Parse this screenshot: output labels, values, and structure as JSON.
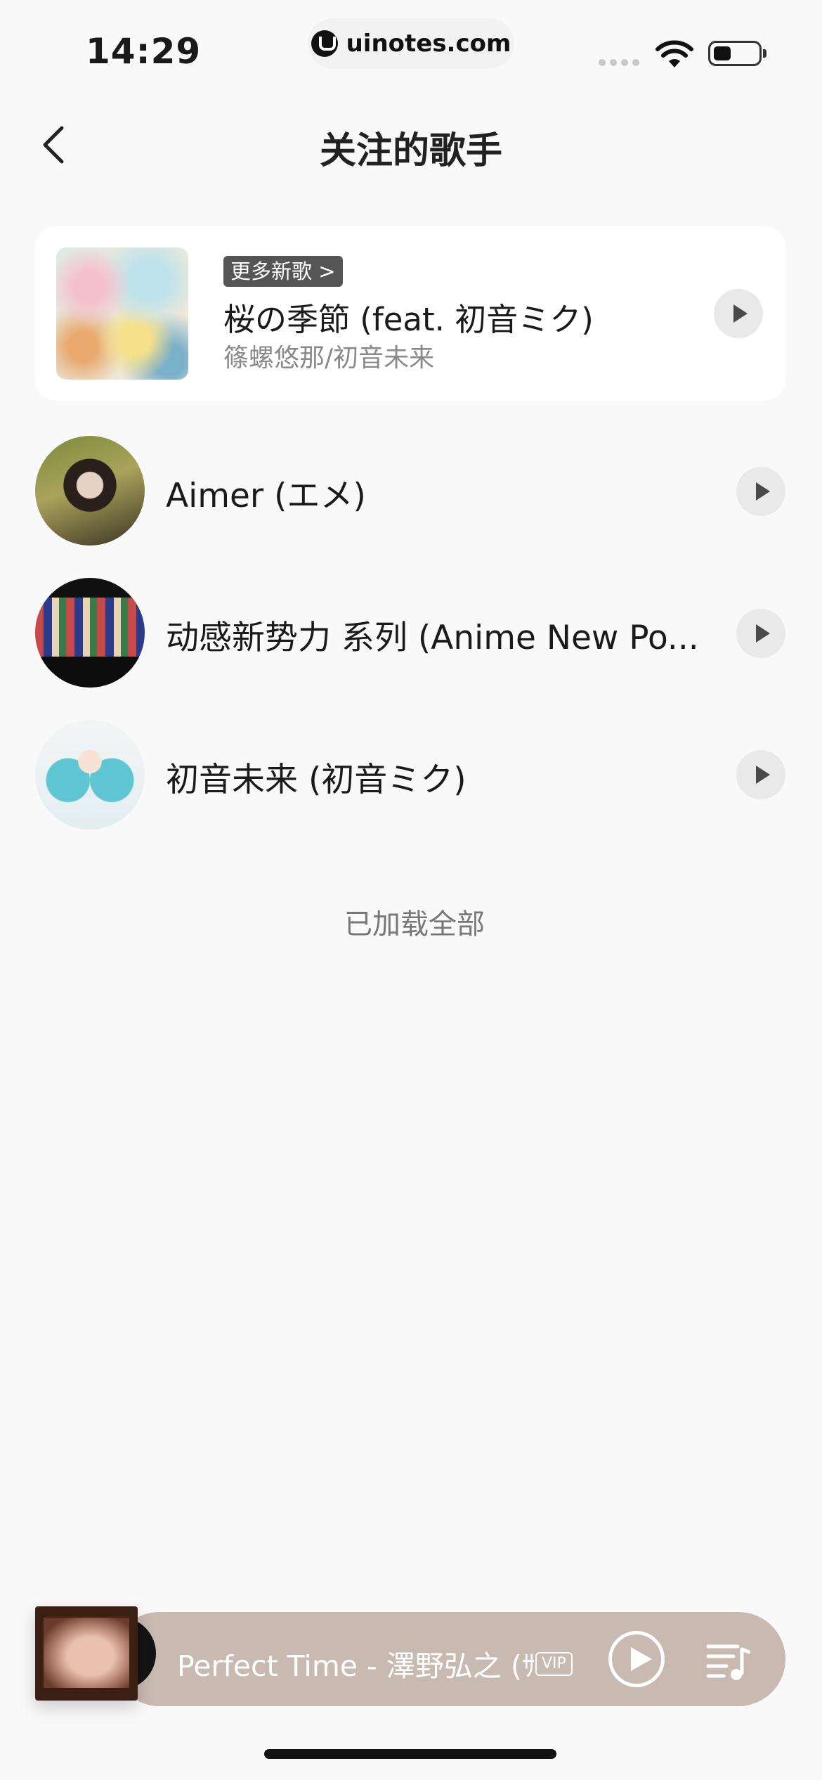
{
  "status_bar": {
    "time": "14:29",
    "url": "uinotes.com",
    "battery_level": 0.4
  },
  "header": {
    "title": "关注的歌手"
  },
  "featured": {
    "badge": "更多新歌 >",
    "song": "桜の季節 (feat. 初音ミク)",
    "artist": "篠螺悠那/初音未来"
  },
  "artists": [
    {
      "name": "Aimer (エメ)"
    },
    {
      "name": "动感新势力 系列 (Anime New Po..."
    },
    {
      "name": "初音未来 (初音ミク)"
    }
  ],
  "footer_text": "已加载全部",
  "player": {
    "now_playing": "Perfect Time - 澤野弘之 (ｻﾜﾉﾋﾛﾕｷ)",
    "vip_label": "VIP"
  },
  "colors": {
    "background": "#f9f9f9",
    "player_bar": "#c8b9b1",
    "badge": "#555555"
  }
}
